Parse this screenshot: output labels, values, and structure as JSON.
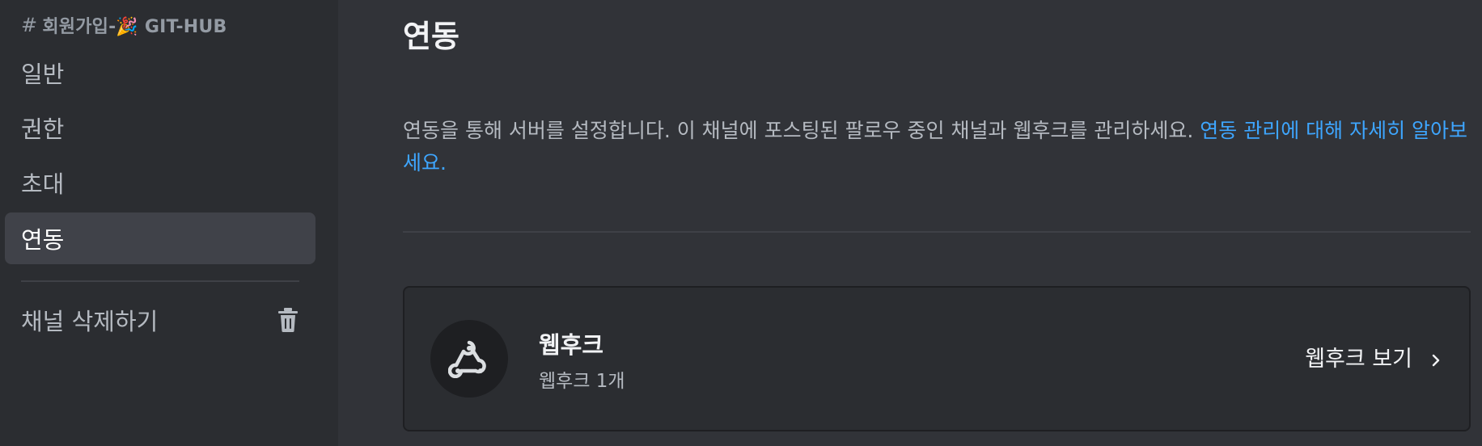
{
  "sidebar": {
    "channel_hash": "#",
    "channel_name": "회원가입-🎉 GIT-HUB",
    "items": [
      {
        "label": "일반",
        "active": false
      },
      {
        "label": "권한",
        "active": false
      },
      {
        "label": "초대",
        "active": false
      },
      {
        "label": "연동",
        "active": true
      }
    ],
    "delete_label": "채널 삭제하기",
    "delete_icon": "trash-icon"
  },
  "main": {
    "title": "연동",
    "description": "연동을 통해 서버를 설정합니다. 이 채널에 포스팅된 팔로우 중인 채널과 웹후크를 관리하세요. ",
    "learn_more_link": "연동 관리에 대해 자세히 알아보세요.",
    "webhook_card": {
      "icon": "webhook-icon",
      "title": "웹후크",
      "count_text": "웹후크 1개",
      "view_label": "웹후크 보기",
      "view_icon": "chevron-right-icon"
    }
  },
  "colors": {
    "background": "#313338",
    "sidebar": "#2b2d31",
    "active_item": "#404249",
    "link": "#3ea6ff"
  }
}
